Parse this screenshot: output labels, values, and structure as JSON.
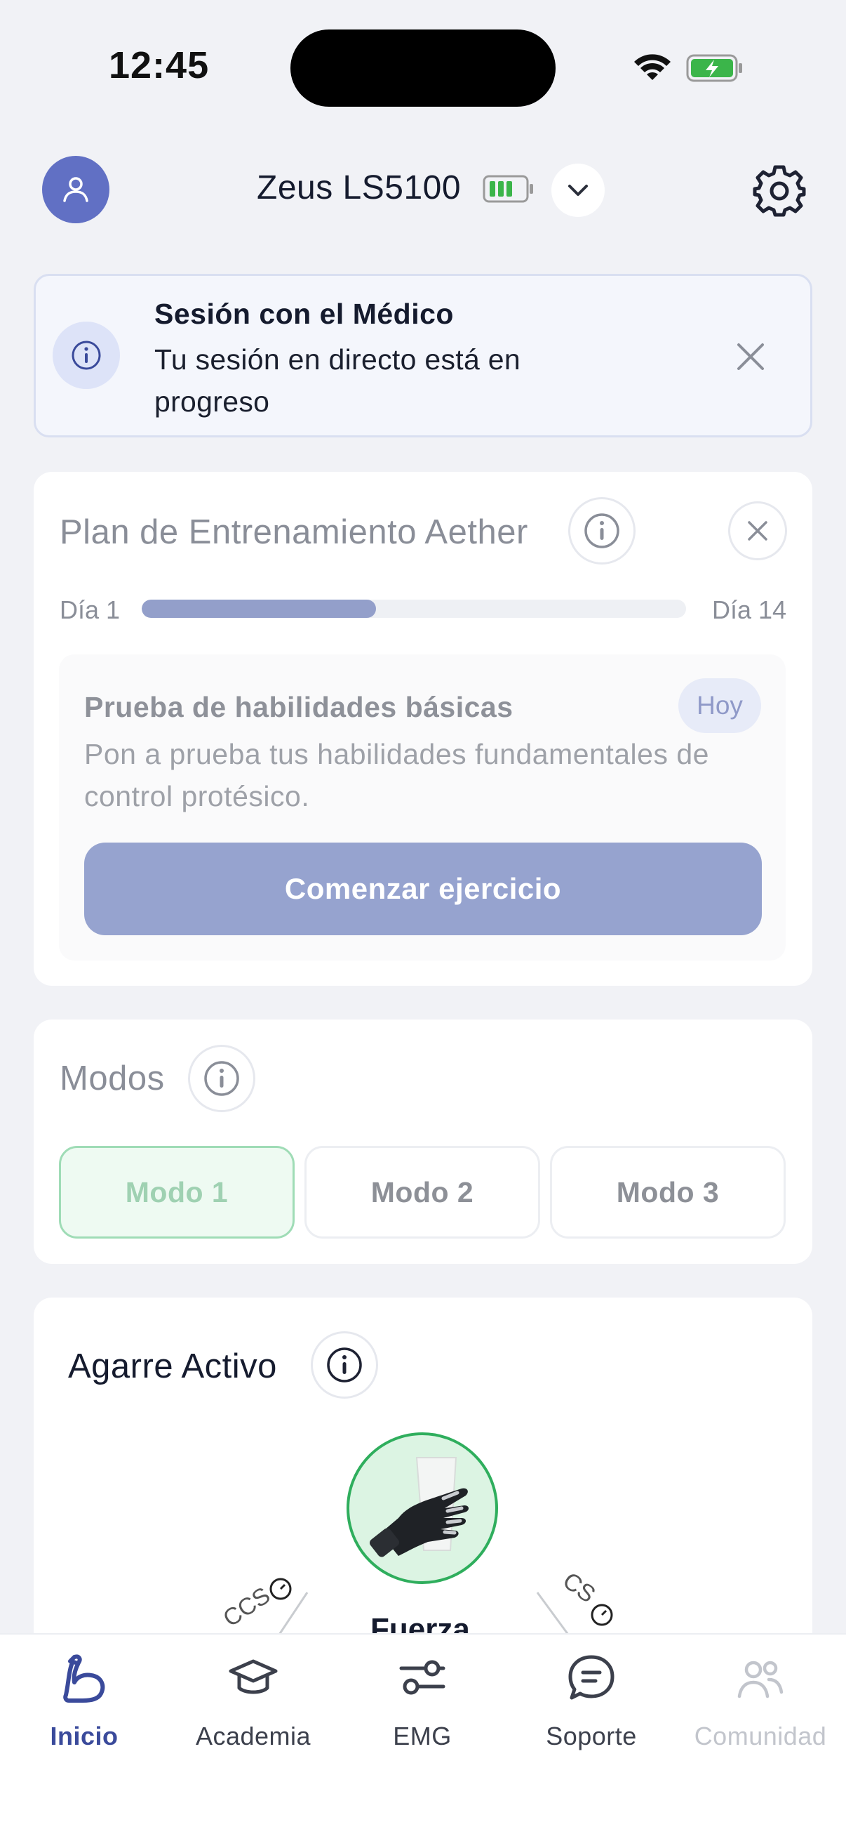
{
  "status_bar": {
    "time": "12:45"
  },
  "header": {
    "device_name": "Zeus LS5100"
  },
  "session_banner": {
    "title": "Sesión con el Médico",
    "text": "Tu sesión en directo está en progreso"
  },
  "training_plan": {
    "title": "Plan de Entrenamiento Aether",
    "day_start": "Día 1",
    "day_end": "Día 14",
    "progress_fraction": 0.43,
    "exercise": {
      "title": "Prueba de habilidades básicas",
      "badge": "Hoy",
      "description": "Pon a prueba tus habilidades fundamentales de control protésico.",
      "button_label": "Comenzar ejercicio"
    }
  },
  "modes": {
    "title": "Modos",
    "items": [
      "Modo 1",
      "Modo 2",
      "Modo 3"
    ],
    "selected": "Modo 1"
  },
  "active_grip": {
    "title": "Agarre Activo",
    "grip_label": "Fuerza",
    "left_arc_label": "CCS",
    "right_arc_label": "CS"
  },
  "tabbar": {
    "items": [
      {
        "label": "Inicio",
        "icon": "bicep-icon",
        "state": "active"
      },
      {
        "label": "Academia",
        "icon": "graduation-cap-icon",
        "state": "normal"
      },
      {
        "label": "EMG",
        "icon": "sliders-icon",
        "state": "normal"
      },
      {
        "label": "Soporte",
        "icon": "chat-bubble-icon",
        "state": "normal"
      },
      {
        "label": "Comunidad",
        "icon": "people-icon",
        "state": "disabled"
      }
    ]
  },
  "colors": {
    "accent": "#3a4a9b",
    "avatar": "#6170c4",
    "progress": "#939fca",
    "grip_green": "#2fae5d",
    "battery_green": "#3bb54a"
  }
}
